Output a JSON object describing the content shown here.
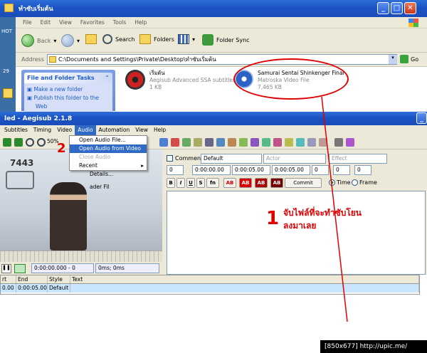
{
  "explorer": {
    "title": "ทำซับเริ่มต้น",
    "menu": [
      "File",
      "Edit",
      "View",
      "Favorites",
      "Tools",
      "Help"
    ],
    "toolbar": {
      "back": "Back",
      "search": "Search",
      "folders": "Folders",
      "folder_sync": "Folder Sync"
    },
    "address_label": "Address",
    "address_value": "C:\\Documents and Settings\\Private\\Desktop\\ทำซับเริ่มต้น",
    "go_label": "Go",
    "tasks_header": "File and Folder Tasks",
    "tasks": [
      "Make a new folder",
      "Publish this folder to the",
      "Web"
    ],
    "files": [
      {
        "name": "เริ่มต้น",
        "type": "Aegisub Advanced SSA subtitles",
        "size": "1 KB"
      },
      {
        "name": "Samurai Sentai Shinkenger Final",
        "type": "Matroska Video File",
        "size": "7,465 KB"
      }
    ]
  },
  "desktop": {
    "hot": "HOT",
    "num29": "29"
  },
  "aegisub": {
    "title": "led - Aegisub 2.1.8",
    "menu": [
      "Subtitles",
      "Timing",
      "Video",
      "Audio",
      "Automation",
      "View",
      "Help"
    ],
    "active_menu": "Audio",
    "zoom": "50%",
    "audio_menu": [
      "Open Audio File...",
      "Open Audio from Video",
      "Close Audio",
      "Recent"
    ],
    "video_overlay_text": "7443",
    "behind_menu_text": [
      "Details...",
      "ader Fil"
    ],
    "comment_label": "Comment",
    "style_value": "Default",
    "actor_placeholder": "Actor",
    "effect_placeholder": "Effect",
    "layer": "0",
    "start_time": "0:00:00.00",
    "end_time": "0:00:05.00",
    "duration": "0:00:05.00",
    "margins": [
      "0",
      "0",
      "0"
    ],
    "format_buttons": [
      "B",
      "I",
      "U",
      "S",
      "fn",
      "AB",
      "AB",
      "AB",
      "AB"
    ],
    "commit_label": "Commit",
    "time_label": "Time",
    "frame_label": "Frame",
    "video_time": "0:00:00.000 - 0",
    "video_offset": "0ms; 0ms",
    "grid_headers": [
      "rt",
      "End",
      "Style",
      "Text"
    ],
    "grid_row": [
      "0.00",
      "0:00:05.00",
      "Default",
      ""
    ]
  },
  "annotations": {
    "step1": "1",
    "step2": "2",
    "instruction_line1": "จับไฟล์ที่จะทำซับโยน",
    "instruction_line2": "ลงมาเลย"
  },
  "watermark": "[850x677] http://upic.me/",
  "colors": {
    "accent": "#316ac5",
    "annotation": "#e00000",
    "title_bar": "#1b52c4"
  }
}
